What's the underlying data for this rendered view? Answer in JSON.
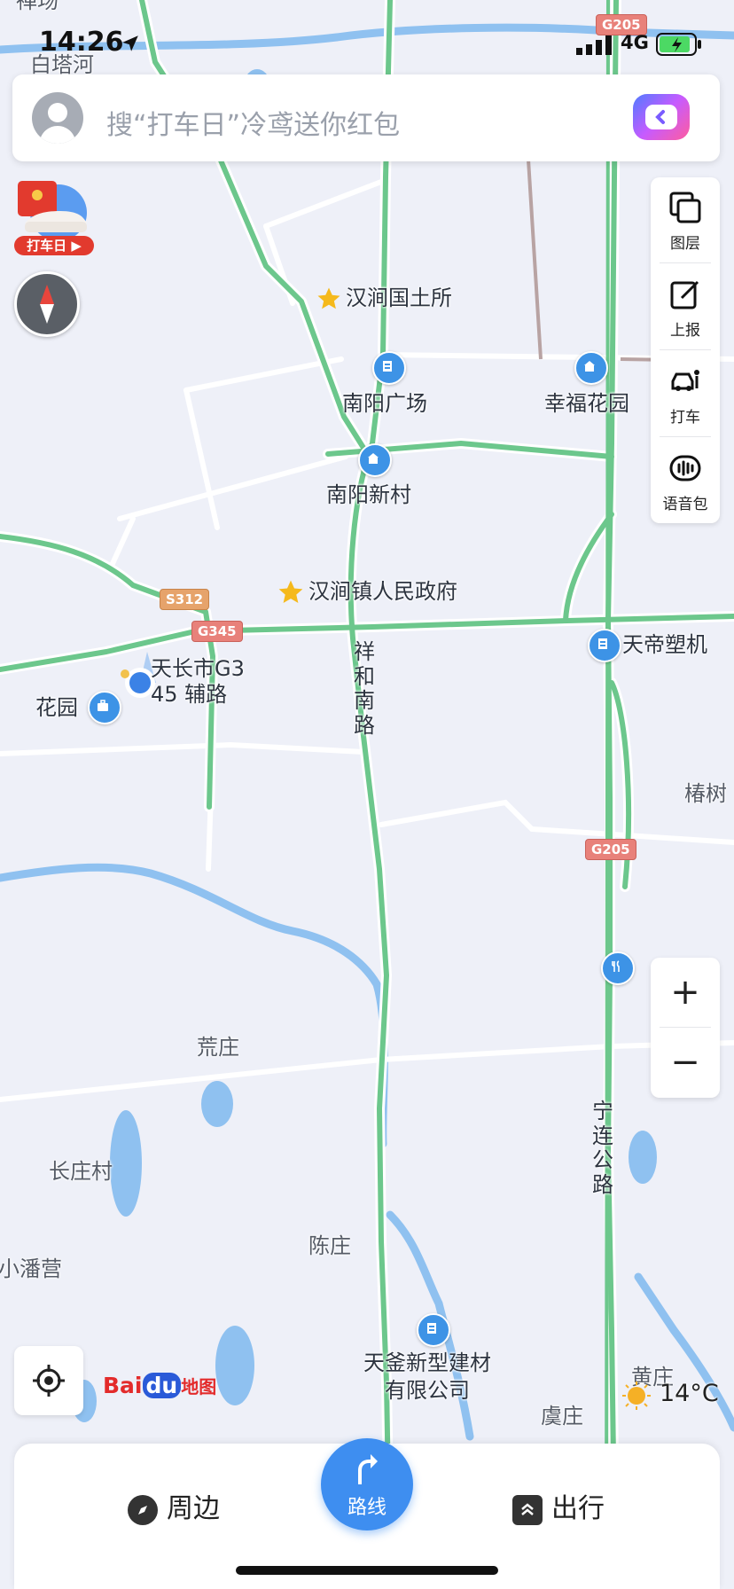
{
  "status_bar": {
    "time": "14:26",
    "network": "4G"
  },
  "search": {
    "placeholder": "搜“打车日”冷鸢送你红包"
  },
  "promo_badge": "打车日",
  "toolbar": {
    "layers": "图层",
    "report": "上报",
    "taxi": "打车",
    "voice_pack": "语音包"
  },
  "map": {
    "places": {
      "top_left_clip": "白塔河",
      "top_left_clip2": "禅场",
      "landmark_1": "汉涧国土所",
      "landmark_2": "南阳广场",
      "landmark_3": "幸福花园",
      "landmark_4": "南阳新村",
      "landmark_5": "汉涧镇人民政府",
      "landmark_6": "天帝塑机",
      "current_location_line1": "天长市G3",
      "current_location_line2": "45 辅路",
      "garden": "花园",
      "village_1": "荒庄",
      "village_2": "长庄村",
      "village_3": "小潘营",
      "village_4": "陈庄",
      "company_line1": "天釜新型建材",
      "company_line2": "有限公司",
      "village_5": "虞庄",
      "village_6": "黄庄",
      "village_7": "椿树",
      "road_vertical_1": "祥和南路",
      "road_vertical_2": "宁连公路"
    },
    "shields": {
      "g205_top": "G205",
      "s312": "S312",
      "g345": "G345",
      "g205_mid": "G205"
    }
  },
  "map_logo": {
    "part1": "Bai",
    "part2": "du",
    "part3": "地图"
  },
  "weather": {
    "temperature": "14°C"
  },
  "bottom_bar": {
    "nearby": "周边",
    "route": "路线",
    "travel": "出行"
  },
  "colors": {
    "highway": "#6cc78c",
    "water": "#8fc1f0",
    "road": "#ffffff",
    "poi": "#3d93e6",
    "accent": "#3e8ef0"
  }
}
